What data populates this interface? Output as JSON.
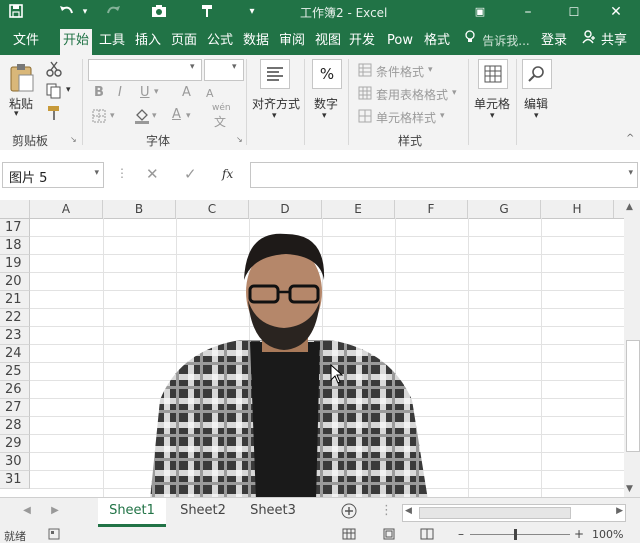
{
  "titlebar": {
    "save_icon": "save-icon",
    "undo_icon": "undo-icon",
    "redo_icon": "redo-icon",
    "camera_icon": "camera-icon",
    "format_painter_icon": "format-painter-icon",
    "title": "工作簿2 - Excel"
  },
  "tabs": [
    "文件",
    "开始",
    "工具",
    "插入",
    "页面",
    "公式",
    "数据",
    "审阅",
    "视图",
    "开发",
    "Pow",
    "格式"
  ],
  "tell_me": "告诉我...",
  "login": "登录",
  "share": "共享",
  "ribbon": {
    "paste": "粘贴",
    "clipboard": "剪贴板",
    "font_group": "字体",
    "bold": "B",
    "italic": "I",
    "underline": "U",
    "font_grow": "A",
    "font_shrink": "A",
    "wen": "wén",
    "wen_char": "文",
    "align": "对齐方式",
    "number": "数字",
    "percent": "%",
    "conditional": "条件格式",
    "table_format": "套用表格格式",
    "cell_style": "单元格样式",
    "styles": "样式",
    "cells": "单元格",
    "edit": "编辑"
  },
  "namebox": "图片 5",
  "fx": "fx",
  "columns": [
    "A",
    "B",
    "C",
    "D",
    "E",
    "F",
    "G",
    "H"
  ],
  "rows": [
    "17",
    "18",
    "19",
    "20",
    "21",
    "22",
    "23",
    "24",
    "25",
    "26",
    "27",
    "28",
    "29",
    "30",
    "31"
  ],
  "sheets": [
    "Sheet1",
    "Sheet2",
    "Sheet3"
  ],
  "status": {
    "ready": "就绪",
    "zoom": "100%"
  },
  "colors": {
    "accent": "#217346"
  }
}
